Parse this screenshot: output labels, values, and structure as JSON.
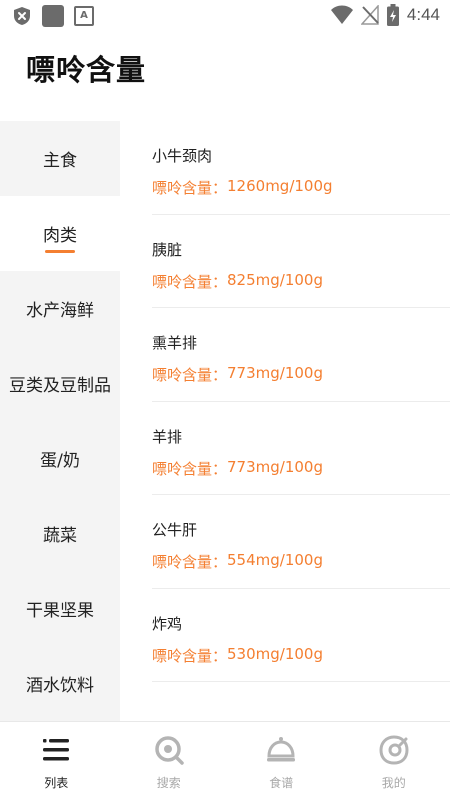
{
  "status_bar": {
    "time": "4:44",
    "left_icons": [
      "shield-x-icon",
      "app-square-icon",
      "a-box-icon"
    ],
    "right_icons": [
      "wifi-icon",
      "no-signal-icon",
      "battery-charging-icon"
    ]
  },
  "header": {
    "title": "嘌呤含量"
  },
  "sidebar": {
    "items": [
      {
        "label": "主食",
        "active": false
      },
      {
        "label": "肉类",
        "active": true
      },
      {
        "label": "水产海鲜",
        "active": false
      },
      {
        "label": "豆类及豆制品",
        "active": false
      },
      {
        "label": "蛋/奶",
        "active": false
      },
      {
        "label": "蔬菜",
        "active": false
      },
      {
        "label": "干果坚果",
        "active": false
      },
      {
        "label": "酒水饮料",
        "active": false
      }
    ]
  },
  "food_list": {
    "purine_prefix": "嘌呤含量：",
    "items": [
      {
        "name": "小牛颈肉",
        "purine": "1260mg/100g"
      },
      {
        "name": "胰脏",
        "purine": "825mg/100g"
      },
      {
        "name": "熏羊排",
        "purine": "773mg/100g"
      },
      {
        "name": "羊排",
        "purine": "773mg/100g"
      },
      {
        "name": "公牛肝",
        "purine": "554mg/100g"
      },
      {
        "name": "炸鸡",
        "purine": "530mg/100g"
      }
    ]
  },
  "bottom_nav": {
    "items": [
      {
        "label": "列表",
        "icon": "list-icon",
        "active": true
      },
      {
        "label": "搜索",
        "icon": "search-icon",
        "active": false
      },
      {
        "label": "食谱",
        "icon": "cloche-icon",
        "active": false
      },
      {
        "label": "我的",
        "icon": "profile-icon",
        "active": false
      }
    ]
  },
  "colors": {
    "accent": "#f47f31",
    "sidebar_bg": "#f4f4f4",
    "nav_inactive": "#a8a8a8",
    "nav_active": "#222222"
  }
}
